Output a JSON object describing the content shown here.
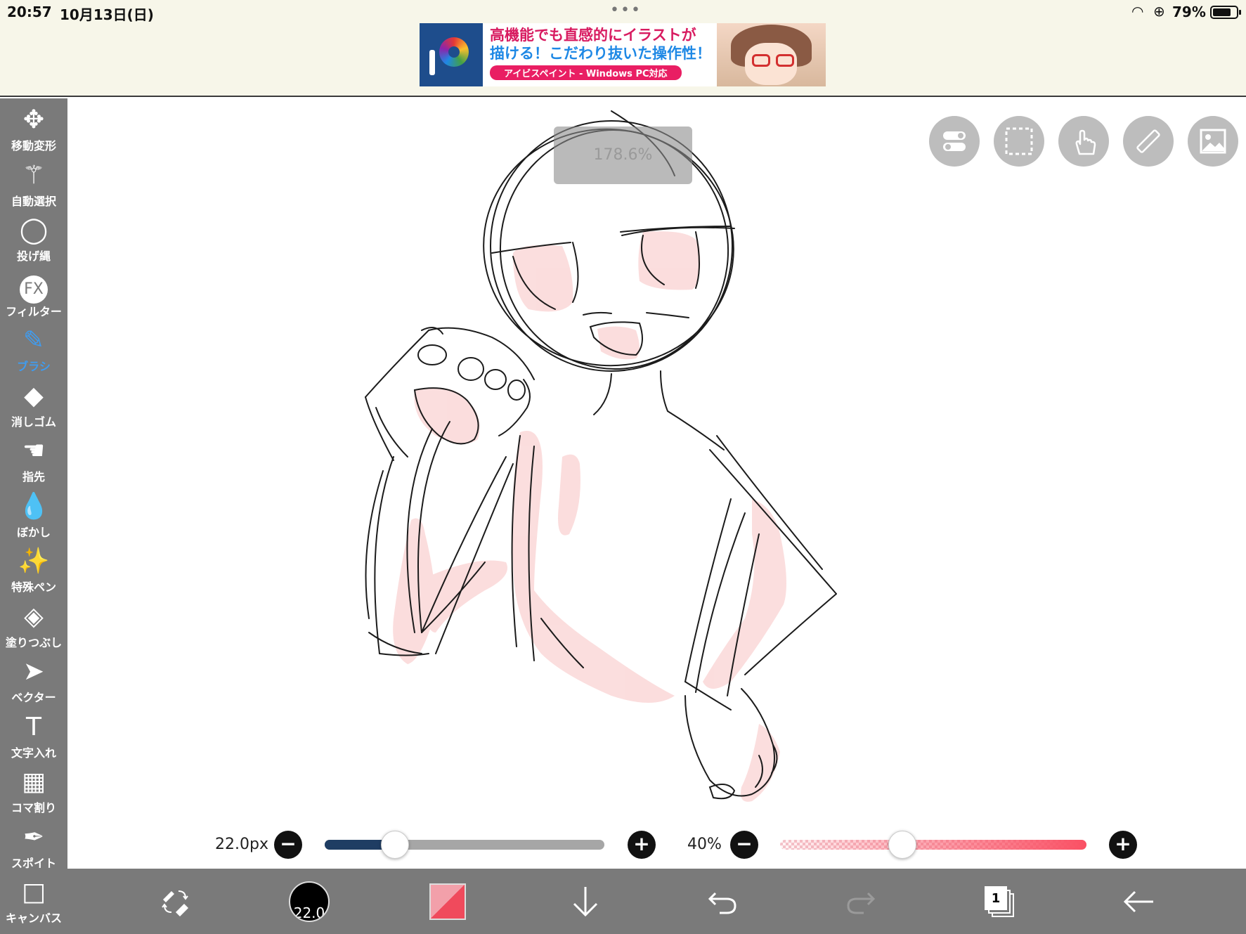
{
  "status_bar": {
    "time": "20:57",
    "date": "10月13日(日)",
    "dots": "•••",
    "wifi_glyph": "◠",
    "lock_glyph": "⊕",
    "battery_percent": "79%",
    "battery_level": 0.79
  },
  "ad": {
    "line1": "高機能でも直感的にイラストが",
    "line2": "描ける！こだわり抜いた操作性！",
    "tagline": "アイビスペイント - Windows PC対応"
  },
  "tools": [
    {
      "name": "move-transform",
      "label": "移動変形",
      "glyph": "✥",
      "icon": "move-icon",
      "active": false
    },
    {
      "name": "magic-wand",
      "label": "自動選択",
      "glyph": "⚚",
      "icon": "magic-wand-icon",
      "active": false
    },
    {
      "name": "lasso",
      "label": "投げ縄",
      "glyph": "◯",
      "icon": "lasso-icon",
      "active": false
    },
    {
      "name": "filter",
      "label": "フィルター",
      "glyph": "FX",
      "icon": "fx-icon",
      "active": false
    },
    {
      "name": "brush",
      "label": "ブラシ",
      "glyph": "✎",
      "icon": "brush-icon",
      "active": true
    },
    {
      "name": "eraser",
      "label": "消しゴム",
      "glyph": "◆",
      "icon": "eraser-icon",
      "active": false
    },
    {
      "name": "smudge",
      "label": "指先",
      "glyph": "☚",
      "icon": "smudge-icon",
      "active": false
    },
    {
      "name": "blur",
      "label": "ぼかし",
      "glyph": "💧",
      "icon": "blur-drop-icon",
      "active": false
    },
    {
      "name": "special-pen",
      "label": "特殊ペン",
      "glyph": "✨",
      "icon": "special-pen-icon",
      "active": false
    },
    {
      "name": "fill",
      "label": "塗りつぶし",
      "glyph": "◈",
      "icon": "fill-bucket-icon",
      "active": false
    },
    {
      "name": "vector",
      "label": "ベクター",
      "glyph": "➤",
      "icon": "vector-arrow-icon",
      "active": false
    },
    {
      "name": "text",
      "label": "文字入れ",
      "glyph": "T",
      "icon": "text-icon",
      "active": false
    },
    {
      "name": "frame-divider",
      "label": "コマ割り",
      "glyph": "▦",
      "icon": "frame-divider-icon",
      "active": false
    },
    {
      "name": "eyedropper",
      "label": "スポイト",
      "glyph": "✒",
      "icon": "eyedropper-icon",
      "active": false
    },
    {
      "name": "canvas",
      "label": "キャンバス",
      "glyph": "□",
      "icon": "canvas-icon",
      "active": false
    }
  ],
  "canvas": {
    "zoom": "178.6%",
    "top_buttons": [
      {
        "name": "toggle-button",
        "icon": "toggle-switch-icon"
      },
      {
        "name": "selection-button",
        "icon": "selection-rect-icon"
      },
      {
        "name": "touch-button",
        "icon": "hand-touch-icon"
      },
      {
        "name": "ruler-button",
        "icon": "ruler-icon"
      },
      {
        "name": "reference-image-button",
        "icon": "image-icon"
      }
    ]
  },
  "brush_size": {
    "value": "22.0px",
    "level": 0.25,
    "minus": "−",
    "plus": "+"
  },
  "opacity": {
    "value": "40%",
    "level": 0.4,
    "minus": "−",
    "plus": "+"
  },
  "bottom_bar": {
    "brush_size_badge": "22.0",
    "layer_count": "1",
    "colors": {
      "primary": "#f04a5c",
      "light": "#f2a0aa",
      "active_tool": "#3f9cf0",
      "toolbar_bg": "#7a7a7a"
    }
  }
}
